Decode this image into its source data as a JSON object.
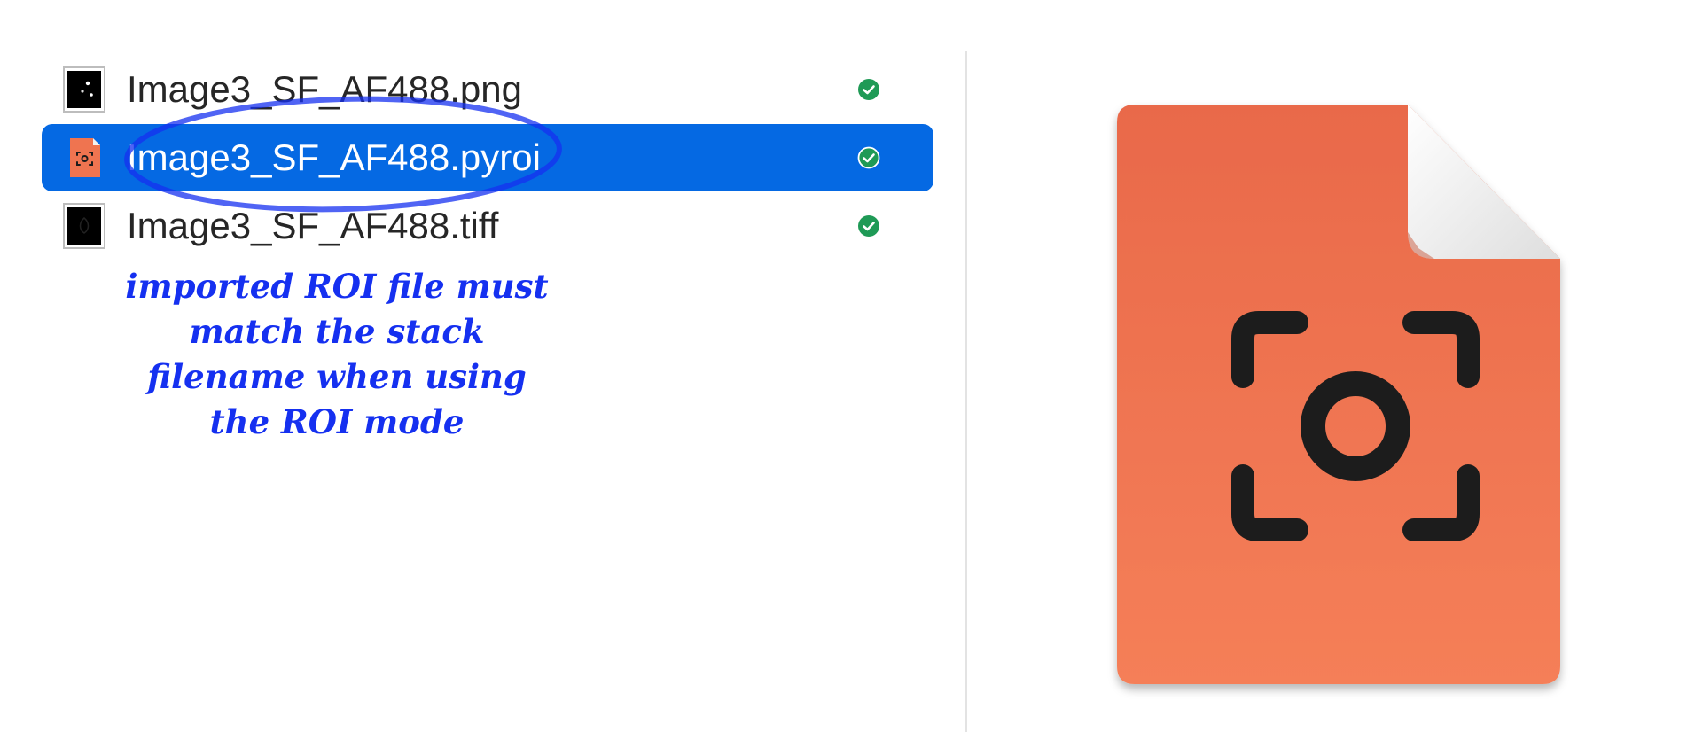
{
  "files": [
    {
      "name": "Image3_SF_AF488.png",
      "thumb": "png-thumbnail-icon",
      "status": "synced-check-icon",
      "selected": false
    },
    {
      "name": "Image3_SF_AF488.pyroi",
      "thumb": "pyroi-file-icon",
      "status": "synced-check-icon",
      "selected": true
    },
    {
      "name": "Image3_SF_AF488.tiff",
      "thumb": "tiff-thumbnail-icon",
      "status": "synced-check-icon",
      "selected": false
    }
  ],
  "annotation": {
    "lines": [
      "imported ROI file must",
      "match the stack",
      "filename when using",
      "the ROI mode"
    ],
    "color": "#1530f0"
  },
  "preview": {
    "icon": "roi-document-icon",
    "fill_color": "#ef7450",
    "fold_color": "#f3f3f3",
    "glyph_color": "#1c1c1c"
  },
  "colors": {
    "selection": "#0569e3",
    "status_green": "#1f9a56",
    "text": "#262626"
  }
}
